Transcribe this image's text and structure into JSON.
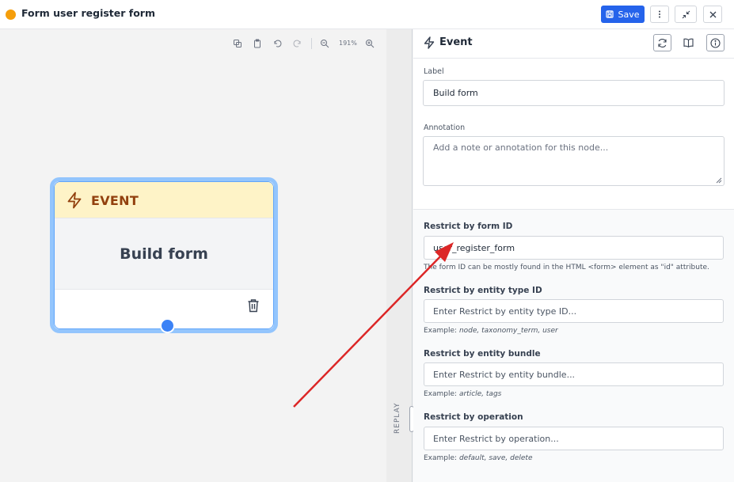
{
  "header": {
    "title": "Form user register form",
    "save_label": "Save",
    "status_color": "#f59e0b",
    "icons": [
      "more-vertical-icon",
      "collapse-icon",
      "close-icon"
    ]
  },
  "canvas": {
    "zoom_level": "191%",
    "toolbar_icons": [
      "copy-icon",
      "paste-icon",
      "undo-icon",
      "redo-icon",
      "zoom-out-icon",
      "zoom-in-icon"
    ],
    "node": {
      "type_label": "EVENT",
      "label": "Build form",
      "header_color": "#fef3c7",
      "accent_color": "#92400e"
    },
    "replay_label": "REPLAY"
  },
  "panel": {
    "title": "Event",
    "label_field": {
      "label": "Label",
      "value": "Build form"
    },
    "annotation_field": {
      "label": "Annotation",
      "placeholder": "Add a note or annotation for this node..."
    },
    "form_id": {
      "label": "Restrict by form ID",
      "value": "user_register_form",
      "help": "The form ID can be mostly found in the HTML <form> element as \"id\" attribute."
    },
    "entity_type": {
      "label": "Restrict by entity type ID",
      "placeholder": "Enter Restrict by entity type ID...",
      "help_prefix": "Example: ",
      "help_example": "node, taxonomy_term, user"
    },
    "entity_bundle": {
      "label": "Restrict by entity bundle",
      "placeholder": "Enter Restrict by entity bundle...",
      "help_prefix": "Example: ",
      "help_example": "article, tags"
    },
    "operation": {
      "label": "Restrict by operation",
      "placeholder": "Enter Restrict by operation...",
      "help_prefix": "Example: ",
      "help_example": "default, save, delete"
    }
  },
  "annotation_arrow_color": "#dc2626"
}
